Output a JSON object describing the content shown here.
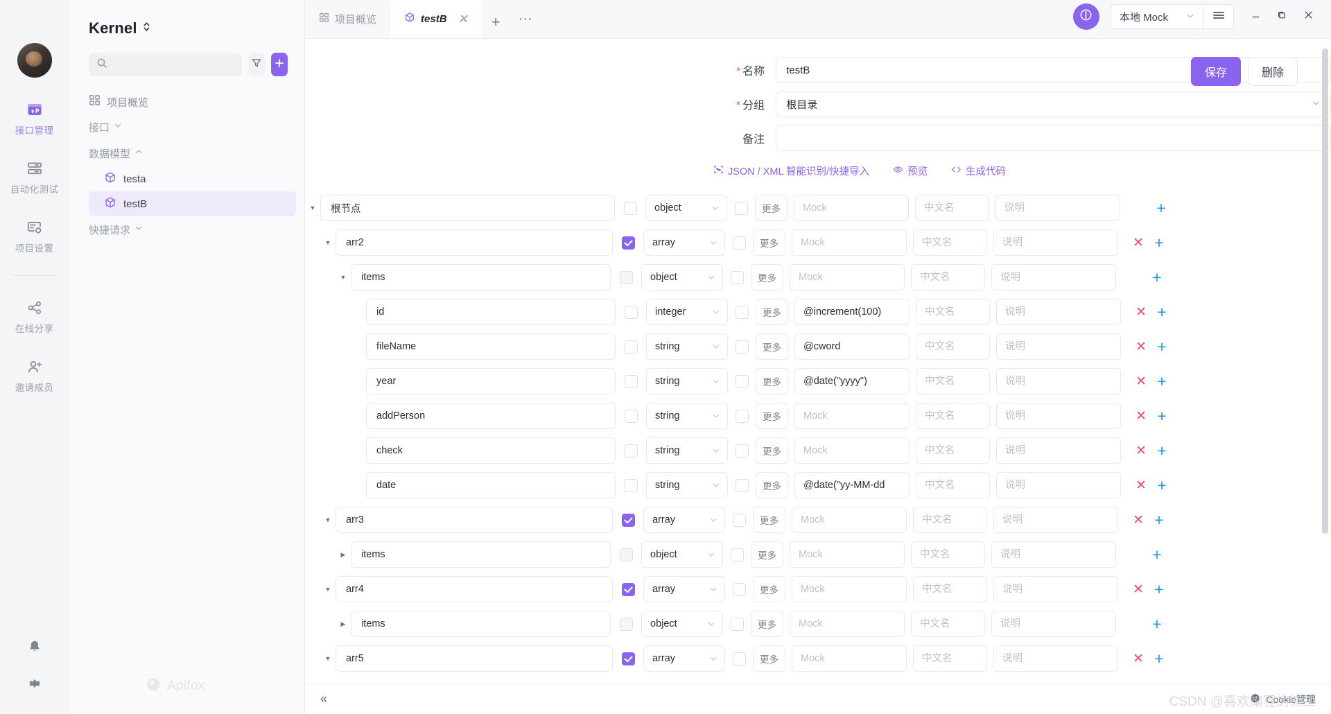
{
  "rail": {
    "avatar_name": "user-avatar",
    "items": [
      {
        "label": "接口管理",
        "icon": "api-manage-icon",
        "active": true
      },
      {
        "label": "自动化测试",
        "icon": "automation-test-icon",
        "active": false
      },
      {
        "label": "项目设置",
        "icon": "project-settings-icon",
        "active": false
      },
      {
        "label": "在线分享",
        "icon": "share-icon",
        "active": false
      },
      {
        "label": "邀请成员",
        "icon": "invite-member-icon",
        "active": false
      }
    ],
    "bottom": [
      {
        "icon": "bell-icon",
        "label": "通知"
      },
      {
        "icon": "gear-icon",
        "label": "设置"
      }
    ]
  },
  "sidebar": {
    "project_title": "Kernel",
    "search_placeholder": "",
    "filter_icon": "filter-icon",
    "add_icon": "plus-icon",
    "overview_label": "项目概览",
    "groups": [
      {
        "label": "接口",
        "expanded": false
      },
      {
        "label": "数据模型",
        "expanded": true
      },
      {
        "label": "快捷请求",
        "expanded": false
      }
    ],
    "models": [
      {
        "label": "testa",
        "selected": false
      },
      {
        "label": "testB",
        "selected": true
      }
    ],
    "watermark": "Apifox"
  },
  "tabs": {
    "items": [
      {
        "label": "项目概览",
        "icon": "grid-icon",
        "active": false,
        "closable": false
      },
      {
        "label": "testB",
        "icon": "cube-icon",
        "active": true,
        "closable": true
      }
    ],
    "add_label": "+",
    "more_label": "···"
  },
  "window": {
    "refresh_icon": "refresh-icon",
    "env_label": "本地 Mock",
    "menu_icon": "hamburger-icon",
    "minimize": "−",
    "maximize": "maximize-icon",
    "close": "✕"
  },
  "form": {
    "fields": [
      {
        "label": "名称",
        "required": true,
        "type": "input",
        "value": "testB",
        "placeholder": ""
      },
      {
        "label": "分组",
        "required": true,
        "type": "select",
        "value": "根目录",
        "placeholder": ""
      },
      {
        "label": "备注",
        "required": false,
        "type": "input",
        "value": "",
        "placeholder": ""
      }
    ],
    "save_label": "保存",
    "delete_label": "删除",
    "helpers": [
      {
        "label": "JSON / XML 智能识别/快捷导入",
        "icon": "import-icon"
      },
      {
        "label": "预览",
        "icon": "eye-icon"
      },
      {
        "label": "生成代码",
        "icon": "code-icon"
      }
    ]
  },
  "schema": {
    "placeholders": {
      "mock": "Mock",
      "cn": "中文名",
      "desc": "说明"
    },
    "more_label": "更多",
    "rows": [
      {
        "name": "根节点",
        "indent": 0,
        "caret": "down",
        "required": false,
        "reqDim": false,
        "type": "object",
        "mock": "",
        "removable": false
      },
      {
        "name": "arr2",
        "indent": 1,
        "caret": "down",
        "required": true,
        "reqDim": false,
        "type": "array",
        "mock": "",
        "removable": true
      },
      {
        "name": "items",
        "indent": 2,
        "caret": "down",
        "required": false,
        "reqDim": true,
        "type": "object",
        "mock": "",
        "removable": false
      },
      {
        "name": "id",
        "indent": 3,
        "caret": "none",
        "required": false,
        "reqDim": false,
        "type": "integer",
        "mock": "@increment(100)",
        "removable": true
      },
      {
        "name": "fileName",
        "indent": 3,
        "caret": "none",
        "required": false,
        "reqDim": false,
        "type": "string",
        "mock": "@cword",
        "removable": true
      },
      {
        "name": "year",
        "indent": 3,
        "caret": "none",
        "required": false,
        "reqDim": false,
        "type": "string",
        "mock": "@date(\"yyyy\")",
        "removable": true
      },
      {
        "name": "addPerson",
        "indent": 3,
        "caret": "none",
        "required": false,
        "reqDim": false,
        "type": "string",
        "mock": "",
        "removable": true
      },
      {
        "name": "check",
        "indent": 3,
        "caret": "none",
        "required": false,
        "reqDim": false,
        "type": "string",
        "mock": "",
        "removable": true
      },
      {
        "name": "date",
        "indent": 3,
        "caret": "none",
        "required": false,
        "reqDim": false,
        "type": "string",
        "mock": "@date(\"yy-MM-dd",
        "removable": true
      },
      {
        "name": "arr3",
        "indent": 1,
        "caret": "down",
        "required": true,
        "reqDim": false,
        "type": "array",
        "mock": "",
        "removable": true
      },
      {
        "name": "items",
        "indent": 2,
        "caret": "right",
        "required": false,
        "reqDim": true,
        "type": "object",
        "mock": "",
        "removable": false
      },
      {
        "name": "arr4",
        "indent": 1,
        "caret": "down",
        "required": true,
        "reqDim": false,
        "type": "array",
        "mock": "",
        "removable": true
      },
      {
        "name": "items",
        "indent": 2,
        "caret": "right",
        "required": false,
        "reqDim": true,
        "type": "object",
        "mock": "",
        "removable": false
      },
      {
        "name": "arr5",
        "indent": 1,
        "caret": "down",
        "required": true,
        "reqDim": false,
        "type": "array",
        "mock": "",
        "removable": true
      }
    ]
  },
  "bottombar": {
    "collapse_icon": "collapse-left-icon",
    "cookie_label": "Cookie管理",
    "cookie_icon": "cookie-icon",
    "watermark": "CSDN @喜欢编程的熊工"
  },
  "colors": {
    "accent": "#8a63f0",
    "danger": "#f2496a",
    "add": "#2196f3",
    "required_star": "#e8556d"
  }
}
